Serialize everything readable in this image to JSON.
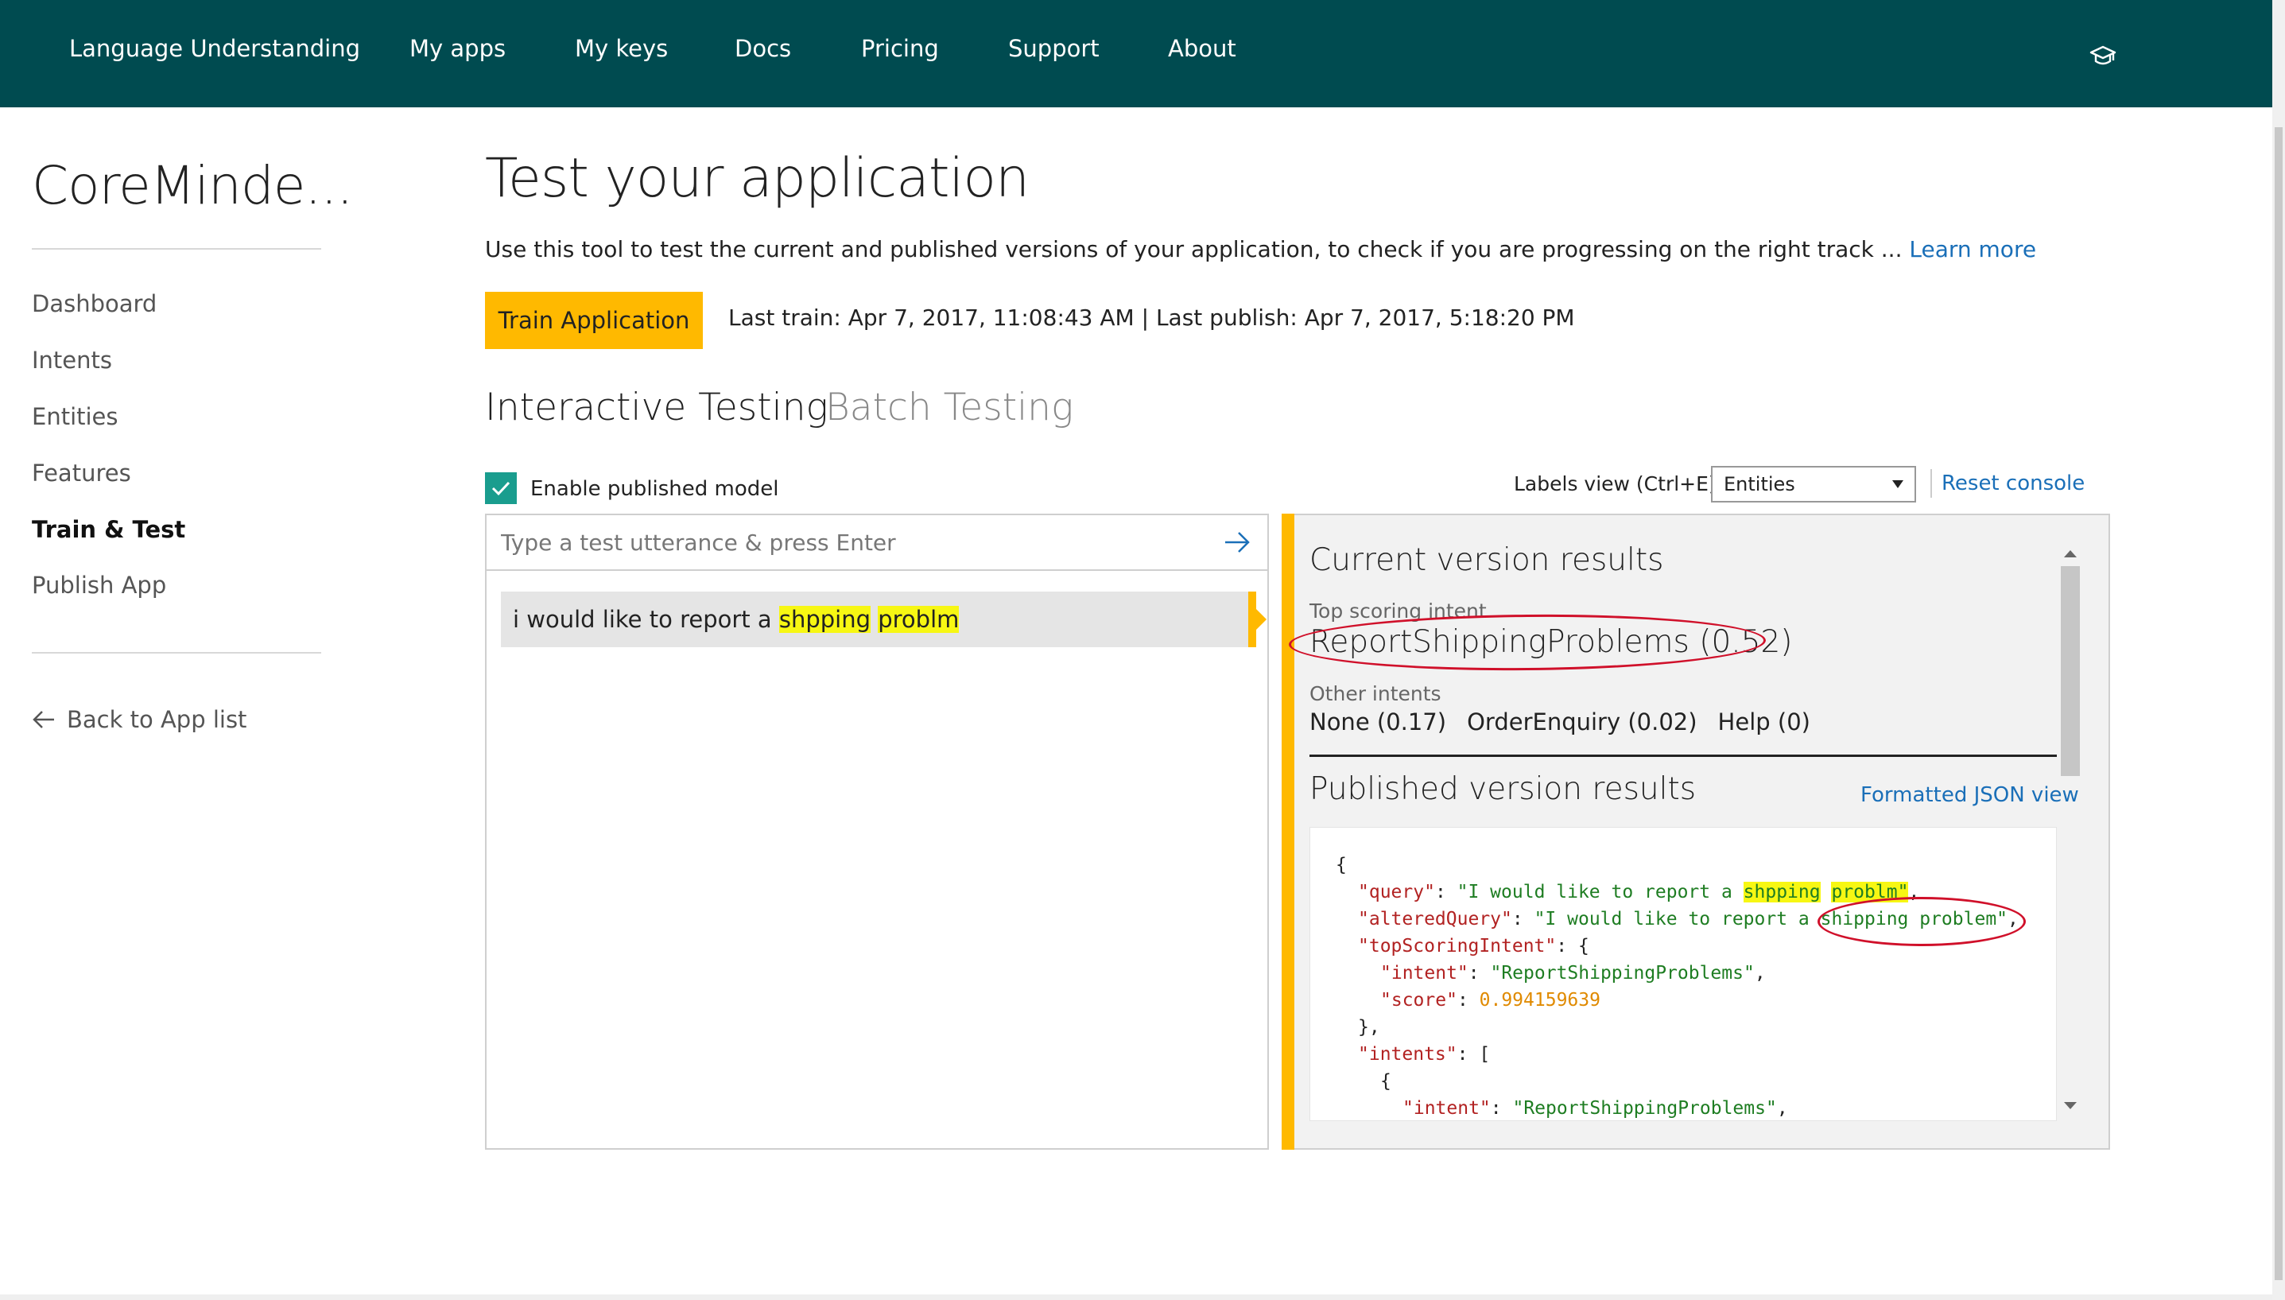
{
  "nav": {
    "items": [
      "Language Understanding",
      "My apps",
      "My keys",
      "Docs",
      "Pricing",
      "Support",
      "About"
    ],
    "help_icon": "graduation-cap-icon"
  },
  "sidebar": {
    "app_name": "CoreMinde...",
    "items": [
      "Dashboard",
      "Intents",
      "Entities",
      "Features",
      "Train & Test",
      "Publish App"
    ],
    "active_item": "Train & Test",
    "back_label": "Back to App list",
    "back_icon": "arrow-left-icon"
  },
  "header": {
    "title": "Test your application",
    "description": "Use this tool to test the current and published versions of your application, to check if you are progressing on the right track ... ",
    "learn_more": "Learn more"
  },
  "train": {
    "button_label": "Train Application",
    "info": "Last train: Apr 7, 2017, 11:08:43 AM  |  Last publish: Apr 7, 2017, 5:18:20 PM"
  },
  "tabs": [
    {
      "label": "Interactive Testing",
      "active": true
    },
    {
      "label": "Batch Testing",
      "active": false
    }
  ],
  "controls": {
    "enable_published_label": "Enable published model",
    "enable_published_checked": true,
    "labels_view_label": "Labels view (Ctrl+E)",
    "labels_view_value": "Entities",
    "reset_label": "Reset console"
  },
  "test": {
    "input_placeholder": "Type a test utterance & press Enter",
    "utterance_prefix": "i would like to report a ",
    "utterance_word1": "shpping",
    "utterance_word2": "problm"
  },
  "current_results": {
    "title": "Current version results",
    "top_label": "Top scoring intent",
    "top_intent": "ReportShippingProblems (0.52)",
    "other_label": "Other intents",
    "other_intents": [
      "None (0.17)",
      "OrderEnquiry (0.02)",
      "Help (0)"
    ]
  },
  "published_results": {
    "title": "Published version results",
    "json_link": "Formatted JSON view",
    "json": {
      "open_brace": "{",
      "query_key": "\"query\"",
      "query_prefix": "\"I would like to report a ",
      "query_word1": "shpping",
      "query_word2": "problm",
      "query_suffix": "\"",
      "altered_key": "\"alteredQuery\"",
      "altered_prefix": "\"I would like to report a ",
      "altered_value": "shipping problem",
      "altered_suffix": "\"",
      "top_key": "\"topScoringIntent\"",
      "intent_key": "\"intent\"",
      "intent_value": "\"ReportShippingProblems\"",
      "score_key": "\"score\"",
      "score_value": "0.994159639",
      "intents_key": "\"intents\"",
      "intent2_value": "\"ReportShippingProblems\""
    }
  }
}
